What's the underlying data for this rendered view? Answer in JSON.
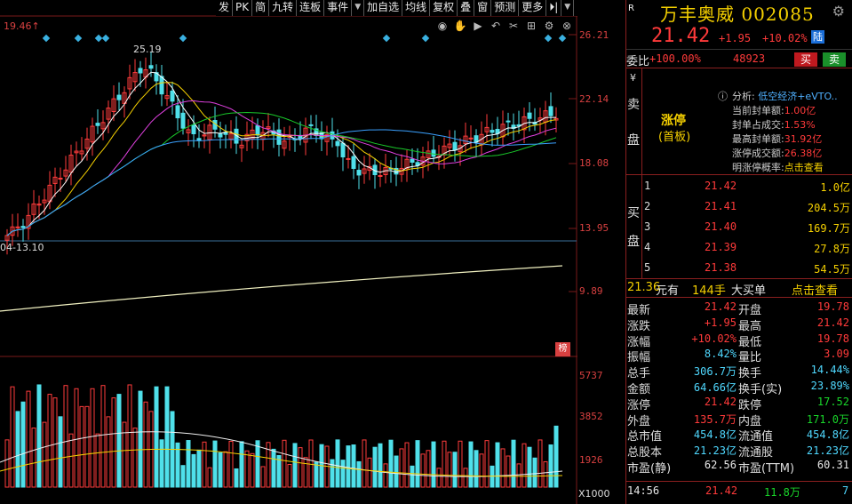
{
  "toolbar": {
    "items": [
      "发",
      "PK",
      "简",
      "九转",
      "连板",
      "事件",
      "加自选",
      "均线",
      "复权",
      "叠",
      "窗",
      "预测",
      "更多"
    ],
    "dropdown_arrow": "▼",
    "extra_arrows": [
      "⏵|",
      "▼"
    ]
  },
  "chart": {
    "high_marker": "19.46↑",
    "peak_label": "25.19",
    "low_label": "04-13.10",
    "price_axis": [
      "26.21",
      "22.14",
      "18.08",
      "13.95",
      "9.89"
    ],
    "volume_axis": [
      "5737",
      "3852",
      "1926"
    ],
    "volume_multiplier": "X1000",
    "tag": "榜",
    "icons": [
      "eye-icon",
      "hand-icon",
      "play-icon",
      "undo-icon",
      "scissors-icon",
      "grid-icon",
      "settings-icon",
      "close-icon"
    ]
  },
  "chart_data": {
    "type": "candlestick",
    "ylim": [
      9.89,
      26.21
    ],
    "volume_ylim": [
      0,
      5737
    ]
  },
  "panel": {
    "r_badge": "R",
    "title": "万丰奥威 002085",
    "last_price": "21.42",
    "change": "+1.95",
    "change_pct": "+10.02%",
    "market_badge": "陆",
    "wb_label": "委比",
    "wb_pct": "+100.00%",
    "wb_num": "48923",
    "buy_btn": "买",
    "sell_btn": "卖",
    "sell_side": [
      "¥",
      "卖",
      "盘"
    ],
    "zt_title": "涨停",
    "zt_sub": "(首板)",
    "analysis": {
      "icon": "ⓘ",
      "label": "分析:",
      "value": "低空经济+eVTO.."
    },
    "info_lines": [
      {
        "label": "当前封单额:",
        "value": "1.00亿"
      },
      {
        "label": "封单占成交:",
        "value": "1.53%"
      },
      {
        "label": "最高封单额:",
        "value": "31.92亿"
      },
      {
        "label": "涨停成交额:",
        "value": "26.38亿"
      },
      {
        "label": "明涨停概率:",
        "value": "点击查看"
      }
    ],
    "buy_side": [
      "买",
      "盘"
    ],
    "order_book": [
      {
        "level": "1",
        "price": "21.42",
        "vol": "1.0亿"
      },
      {
        "level": "2",
        "price": "21.41",
        "vol": "204.5万"
      },
      {
        "level": "3",
        "price": "21.40",
        "vol": "169.7万"
      },
      {
        "level": "4",
        "price": "21.39",
        "vol": "27.8万"
      },
      {
        "level": "5",
        "price": "21.38",
        "vol": "54.5万"
      }
    ],
    "big_order": {
      "price": "21.36",
      "text1": "元有",
      "hands": "144手",
      "text2": "大买单",
      "link": "点击查看"
    },
    "stats": [
      {
        "l": "最新",
        "lv": "21.42",
        "lc": "red",
        "r": "开盘",
        "rv": "19.78",
        "rc": "red"
      },
      {
        "l": "涨跌",
        "lv": "+1.95",
        "lc": "red",
        "r": "最高",
        "rv": "21.42",
        "rc": "red"
      },
      {
        "l": "涨幅",
        "lv": "+10.02%",
        "lc": "red",
        "r": "最低",
        "rv": "19.78",
        "rc": "red"
      },
      {
        "l": "振幅",
        "lv": "8.42%",
        "lc": "cyan",
        "r": "量比",
        "rv": "3.09",
        "rc": "red"
      },
      {
        "l": "总手",
        "lv": "306.7万",
        "lc": "cyan",
        "r": "换手",
        "rv": "14.44%",
        "rc": "cyan"
      },
      {
        "l": "金额",
        "lv": "64.66亿",
        "lc": "cyan",
        "r": "换手(实)",
        "rv": "23.89%",
        "rc": "cyan"
      },
      {
        "l": "涨停",
        "lv": "21.42",
        "lc": "red",
        "r": "跌停",
        "rv": "17.52",
        "rc": "green"
      },
      {
        "l": "外盘",
        "lv": "135.7万",
        "lc": "red",
        "r": "内盘",
        "rv": "171.0万",
        "rc": "green"
      },
      {
        "l": "总市值",
        "lv": "454.8亿",
        "lc": "cyan",
        "r": "流通值",
        "rv": "454.8亿",
        "rc": "cyan"
      },
      {
        "l": "总股本",
        "lv": "21.23亿",
        "lc": "cyan",
        "r": "流通股",
        "rv": "21.23亿",
        "rc": "cyan"
      },
      {
        "l": "市盈(静)",
        "lv": "62.56",
        "lc": "white",
        "r": "市盈(TTM)",
        "rv": "60.31",
        "rc": "white"
      }
    ],
    "tick": {
      "time": "14:56",
      "price": "21.42",
      "vol": "11.8万",
      "count": "7"
    }
  }
}
